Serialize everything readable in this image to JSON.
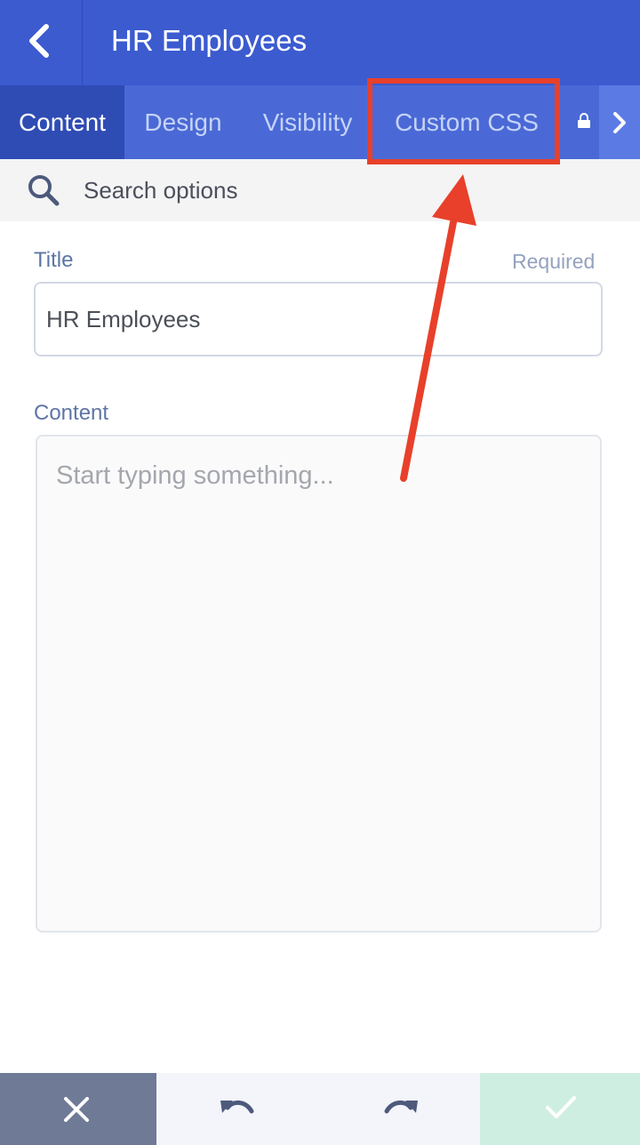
{
  "header": {
    "title": "HR Employees",
    "back_icon": "chevron-left-icon"
  },
  "tabs": [
    {
      "label": "Content",
      "active": true
    },
    {
      "label": "Design",
      "active": false
    },
    {
      "label": "Visibility",
      "active": false
    },
    {
      "label": "Custom CSS",
      "active": false,
      "highlighted": true
    }
  ],
  "tab_extras": {
    "lock_icon": "lock-icon",
    "next_icon": "chevron-right-icon"
  },
  "search": {
    "placeholder": "Search options",
    "icon": "search-icon"
  },
  "form": {
    "title_label": "Title",
    "required_label": "Required",
    "title_value": "HR Employees",
    "content_label": "Content",
    "content_placeholder": "Start typing something...",
    "content_value": ""
  },
  "bottom_bar": {
    "cancel_icon": "close-icon",
    "undo_icon": "undo-icon",
    "redo_icon": "redo-icon",
    "save_icon": "checkmark-icon"
  },
  "colors": {
    "header_bg": "#3b5bcf",
    "tab_bar_bg": "#4a69d6",
    "active_tab_bg": "#2f4cb5",
    "annotation_red": "#e8402a",
    "cancel_bg": "#6f7a97",
    "save_bg": "#cfeee2"
  }
}
